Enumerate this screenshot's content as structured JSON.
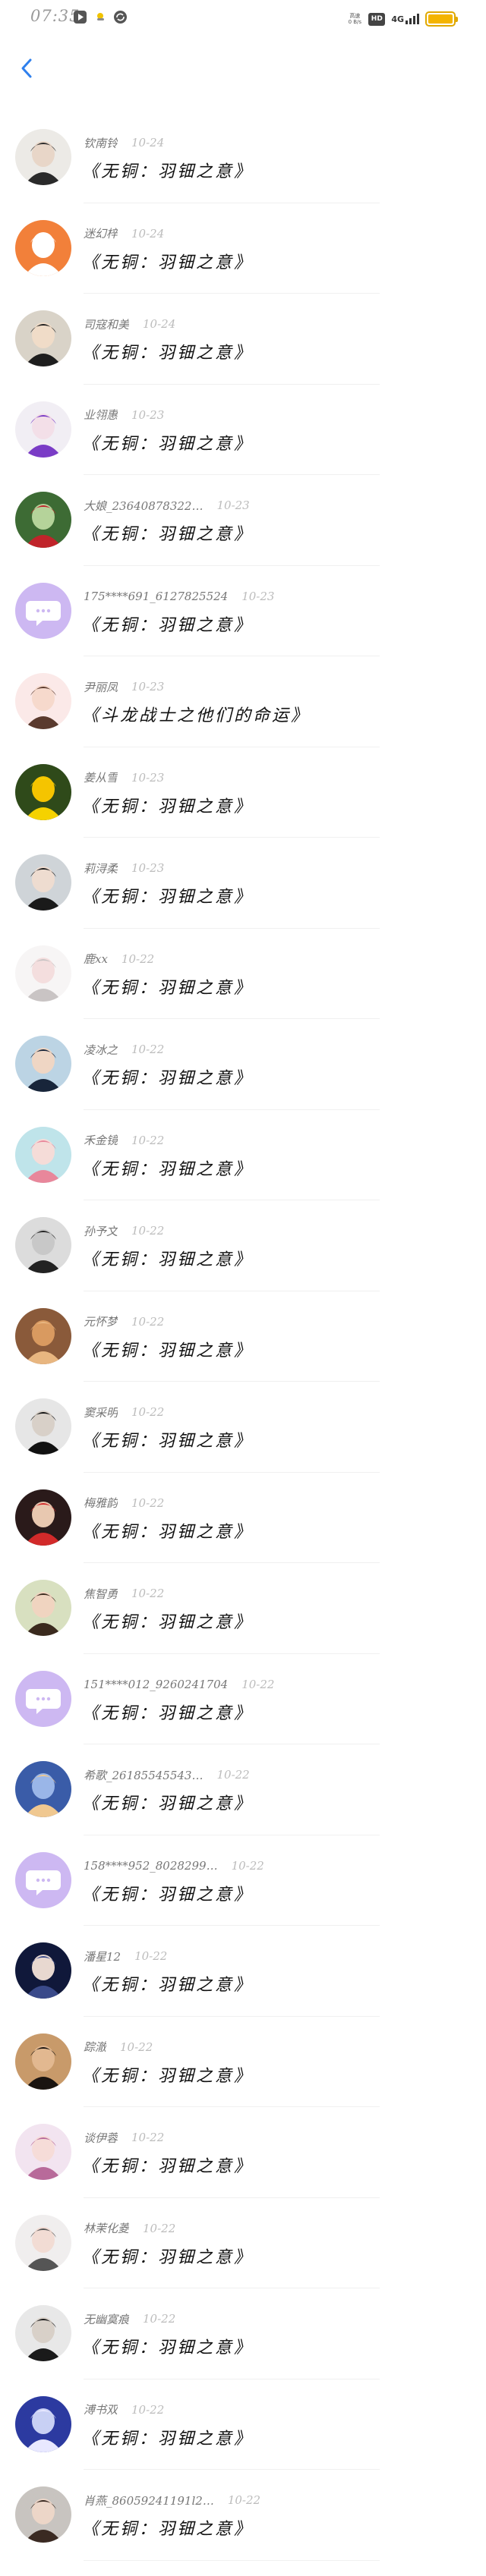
{
  "statusbar": {
    "time": "07:35",
    "net_label": "高速",
    "net_speed": "0 B/s",
    "hd": "HD",
    "signal": "4G"
  },
  "nav": {
    "back_icon": "chevron-left-icon",
    "accent": "#2f80ed"
  },
  "messages": [
    {
      "name": "钦南铃",
      "date": "10-24",
      "text": "《无铜：羽钿之意》",
      "avatar": {
        "bg": "#eceae6",
        "fg": "#2a2a2a",
        "skin": "#e8d6c8"
      }
    },
    {
      "name": "迷幻梓",
      "date": "10-24",
      "text": "《无铜：羽钿之意》",
      "avatar": {
        "bg": "#f2803a",
        "fg": "#ffffff",
        "skin": "#ffffff"
      }
    },
    {
      "name": "司寇和美",
      "date": "10-24",
      "text": "《无铜：羽钿之意》",
      "avatar": {
        "bg": "#d9d3c8",
        "fg": "#1e1e1e",
        "skin": "#f0dcc8"
      }
    },
    {
      "name": "业翎惠",
      "date": "10-23",
      "text": "《无铜：羽钿之意》",
      "avatar": {
        "bg": "#f1eef4",
        "fg": "#7a3cc6",
        "skin": "#f3dfe8"
      }
    },
    {
      "name": "大娘_23640878322…",
      "date": "10-23",
      "text": "《无铜：羽钿之意》",
      "avatar": {
        "bg": "#3d6b34",
        "fg": "#c0242a",
        "skin": "#b5d39a"
      }
    },
    {
      "name": "175****691_6127825524",
      "date": "10-23",
      "text": "《无铜：羽钿之意》",
      "avatar": {
        "bg": "#cdb8f2",
        "fg": "#ffffff",
        "skin": "#ffffff"
      }
    },
    {
      "name": "尹丽凤",
      "date": "10-23",
      "text": "《斗龙战士之他们的命运》",
      "avatar": {
        "bg": "#fbe9e8",
        "fg": "#5a3a2e",
        "skin": "#f6d9cc"
      }
    },
    {
      "name": "姜从雪",
      "date": "10-23",
      "text": "《无铜：羽钿之意》",
      "avatar": {
        "bg": "#2f4a1a",
        "fg": "#f5d200",
        "skin": "#f5c400"
      }
    },
    {
      "name": "莉浔柔",
      "date": "10-23",
      "text": "《无铜：羽钿之意》",
      "avatar": {
        "bg": "#cfd4d8",
        "fg": "#1a1a1a",
        "skin": "#eedcd0"
      }
    },
    {
      "name": "鹿xx",
      "date": "10-22",
      "text": "《无铜：羽钿之意》",
      "avatar": {
        "bg": "#f7f5f5",
        "fg": "#c9c4c4",
        "skin": "#f4dede"
      }
    },
    {
      "name": "凌冰之",
      "date": "10-22",
      "text": "《无铜：羽钿之意》",
      "avatar": {
        "bg": "#bcd4e4",
        "fg": "#18253a",
        "skin": "#efd6c4"
      }
    },
    {
      "name": "禾金镜",
      "date": "10-22",
      "text": "《无铜：羽钿之意》",
      "avatar": {
        "bg": "#bfe4ea",
        "fg": "#e8879b",
        "skin": "#f5dcd8"
      }
    },
    {
      "name": "孙予文",
      "date": "10-22",
      "text": "《无铜：羽钿之意》",
      "avatar": {
        "bg": "#dcdcdc",
        "fg": "#222222",
        "skin": "#c8c8c8"
      }
    },
    {
      "name": "元怀梦",
      "date": "10-22",
      "text": "《无铜：羽钿之意》",
      "avatar": {
        "bg": "#8a5a3a",
        "fg": "#e8b680",
        "skin": "#d99a60"
      }
    },
    {
      "name": "窦采明",
      "date": "10-22",
      "text": "《无铜：羽钿之意》",
      "avatar": {
        "bg": "#e6e6e6",
        "fg": "#111111",
        "skin": "#d8d0c8"
      }
    },
    {
      "name": "梅雅韵",
      "date": "10-22",
      "text": "《无铜：羽钿之意》",
      "avatar": {
        "bg": "#2a1a1a",
        "fg": "#d22a2a",
        "skin": "#e8c8b0"
      }
    },
    {
      "name": "焦智勇",
      "date": "10-22",
      "text": "《无铜：羽钿之意》",
      "avatar": {
        "bg": "#d8e0c0",
        "fg": "#3a2a1e",
        "skin": "#f0d4c0"
      }
    },
    {
      "name": "151****012_9260241704",
      "date": "10-22",
      "text": "《无铜：羽钿之意》",
      "avatar": {
        "bg": "#cdb8f2",
        "fg": "#ffffff",
        "skin": "#ffffff"
      }
    },
    {
      "name": "希歌_26185545543…",
      "date": "10-22",
      "text": "《无铜：羽钿之意》",
      "avatar": {
        "bg": "#3a5ca8",
        "fg": "#f0c890",
        "skin": "#9ab6e8"
      }
    },
    {
      "name": "158****952_8028299…",
      "date": "10-22",
      "text": "《无铜：羽钿之意》",
      "avatar": {
        "bg": "#cdb8f2",
        "fg": "#ffffff",
        "skin": "#ffffff"
      }
    },
    {
      "name": "潘星12",
      "date": "10-22",
      "text": "《无铜：羽钿之意》",
      "avatar": {
        "bg": "#10183a",
        "fg": "#3a4a8a",
        "skin": "#e8d8d0"
      }
    },
    {
      "name": "踪澈",
      "date": "10-22",
      "text": "《无铜：羽钿之意》",
      "avatar": {
        "bg": "#c89a6a",
        "fg": "#1a1410",
        "skin": "#e2b890"
      }
    },
    {
      "name": "谈伊蓉",
      "date": "10-22",
      "text": "《无铜：羽钿之意》",
      "avatar": {
        "bg": "#f2e4f0",
        "fg": "#b86a9a",
        "skin": "#f6dcd8"
      }
    },
    {
      "name": "林茉化菱",
      "date": "10-22",
      "text": "《无铜：羽钿之意》",
      "avatar": {
        "bg": "#f0eeee",
        "fg": "#555555",
        "skin": "#f2dcd4"
      }
    },
    {
      "name": "无幽寞痕",
      "date": "10-22",
      "text": "《无铜：羽钿之意》",
      "avatar": {
        "bg": "#e8e8e8",
        "fg": "#1a1a1a",
        "skin": "#d8d0c8"
      }
    },
    {
      "name": "溥书双",
      "date": "10-22",
      "text": "《无铜：羽钿之意》",
      "avatar": {
        "bg": "#2c3aa0",
        "fg": "#e8e8ff",
        "skin": "#c8d0f4"
      }
    },
    {
      "name": "肖燕_86059241191l2…",
      "date": "10-22",
      "text": "《无铜：羽钿之意》",
      "avatar": {
        "bg": "#c8c4c0",
        "fg": "#3a2a22",
        "skin": "#ecd6c8"
      }
    }
  ]
}
